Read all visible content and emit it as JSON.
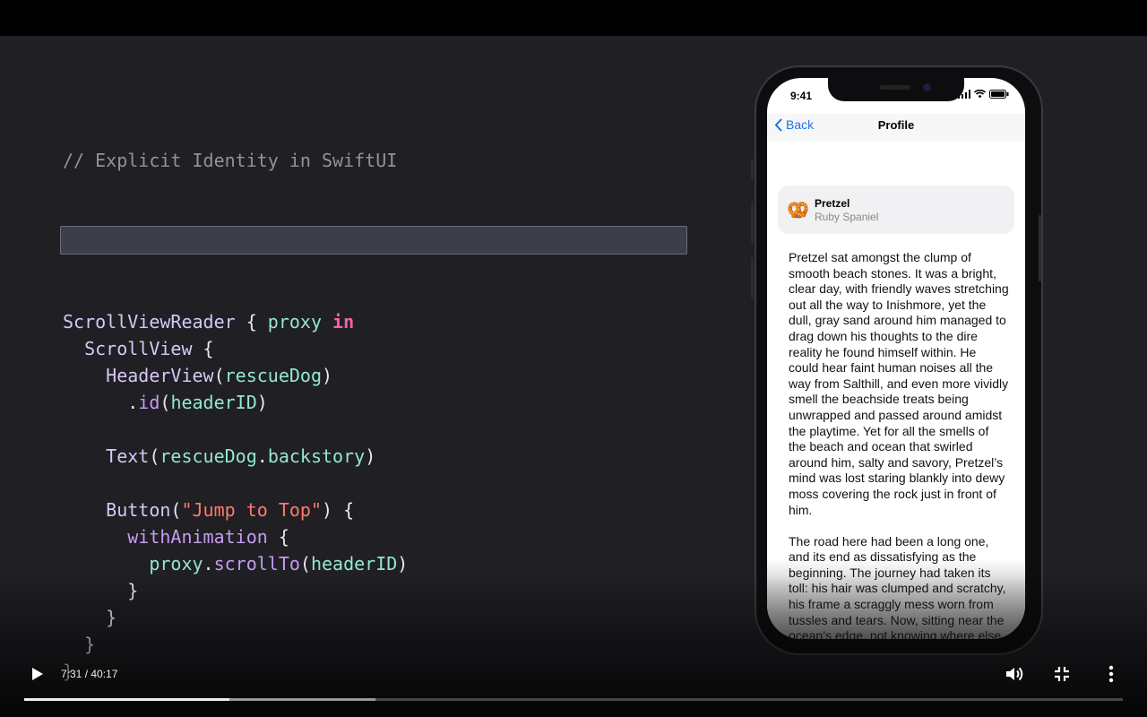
{
  "code": {
    "comment": "// Explicit Identity in SwiftUI",
    "lines": [
      {
        "indent": "",
        "parts": [
          [
            "type",
            "ScrollViewReader"
          ],
          [
            "punc",
            " { "
          ],
          [
            "prop",
            "proxy"
          ],
          [
            "punc",
            " "
          ],
          [
            "key",
            "in"
          ]
        ]
      },
      {
        "indent": "  ",
        "parts": [
          [
            "type",
            "ScrollView"
          ],
          [
            "punc",
            " {"
          ]
        ]
      },
      {
        "indent": "    ",
        "parts": [
          [
            "type",
            "HeaderView"
          ],
          [
            "punc",
            "("
          ],
          [
            "prop",
            "rescueDog"
          ],
          [
            "punc",
            ")"
          ]
        ]
      },
      {
        "indent": "      ",
        "parts": [
          [
            "punc",
            "."
          ],
          [
            "func",
            "id"
          ],
          [
            "punc",
            "("
          ],
          [
            "prop",
            "headerID"
          ],
          [
            "punc",
            ")"
          ]
        ]
      },
      {
        "indent": "",
        "parts": []
      },
      {
        "indent": "    ",
        "parts": [
          [
            "type",
            "Text"
          ],
          [
            "punc",
            "("
          ],
          [
            "prop",
            "rescueDog"
          ],
          [
            "punc",
            "."
          ],
          [
            "prop",
            "backstory"
          ],
          [
            "punc",
            ")"
          ]
        ]
      },
      {
        "indent": "",
        "parts": []
      },
      {
        "indent": "    ",
        "parts": [
          [
            "type",
            "Button"
          ],
          [
            "punc",
            "("
          ],
          [
            "str",
            "\"Jump to Top\""
          ],
          [
            "punc",
            ") {"
          ]
        ]
      },
      {
        "indent": "      ",
        "parts": [
          [
            "func",
            "withAnimation"
          ],
          [
            "punc",
            " {"
          ]
        ]
      },
      {
        "indent": "        ",
        "parts": [
          [
            "prop",
            "proxy"
          ],
          [
            "punc",
            "."
          ],
          [
            "func",
            "scrollTo"
          ],
          [
            "punc",
            "("
          ],
          [
            "prop",
            "headerID"
          ],
          [
            "punc",
            ")"
          ]
        ]
      },
      {
        "indent": "      ",
        "parts": [
          [
            "punc",
            "}"
          ]
        ]
      },
      {
        "indent": "    ",
        "parts": [
          [
            "punc",
            "}"
          ]
        ]
      },
      {
        "indent": "  ",
        "parts": [
          [
            "punc",
            "}"
          ]
        ]
      },
      {
        "indent": "",
        "parts": [
          [
            "punc",
            "}"
          ]
        ]
      }
    ]
  },
  "phone": {
    "time": "9:41",
    "back_label": "Back",
    "title": "Profile",
    "dog_emoji": "🥨",
    "dog_name": "Pretzel",
    "dog_breed": "Ruby Spaniel",
    "paragraphs": [
      "Pretzel sat amongst the clump of smooth beach stones. It was a bright, clear day, with friendly waves stretching out all the way to Inishmore, yet the dull, gray sand around him managed to drag down his thoughts to the dire reality he found himself within. He could hear faint human noises all the way from Salthill, and even more vividly smell the beachside treats being unwrapped and passed around amidst the playtime. Yet for all the smells of the beach and ocean that swirled around him, salty and savory, Pretzel’s mind was lost staring blankly into dewy moss covering the rock just in front of him.",
      "The road here had been a long one, and its end as dissatisfying as the beginning. The journey had taken its toll: his hair was clumped and scratchy, his frame a scraggly mess worn from tussles and tears. Now, sitting near the ocean’s edge, not knowing where else to go, Pretzel let"
    ]
  },
  "player": {
    "time_label": "7:31 / 40:17",
    "played_fraction": 0.187,
    "buffered_fraction": 0.32,
    "icons": [
      "play-icon",
      "volume-icon",
      "exit-fullscreen-icon",
      "more-icon"
    ]
  }
}
